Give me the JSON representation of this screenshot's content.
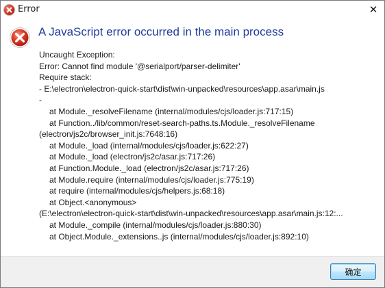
{
  "window": {
    "title": "Error"
  },
  "icons": {
    "title_icon": "error-icon",
    "main_icon": "error-icon",
    "close_icon": "close-icon"
  },
  "dialog": {
    "headline": "A JavaScript error occurred in the main process",
    "message_lines": [
      {
        "text": "Uncaught Exception:",
        "indent": false
      },
      {
        "text": "Error: Cannot find module '@serialport/parser-delimiter'",
        "indent": false
      },
      {
        "text": "Require stack:",
        "indent": false
      },
      {
        "text": "- E:\\electron\\electron-quick-start\\dist\\win-unpacked\\resources\\app.asar\\main.js",
        "indent": false
      },
      {
        "text": "-",
        "indent": false
      },
      {
        "text": "at Module._resolveFilename (internal/modules/cjs/loader.js:717:15)",
        "indent": true
      },
      {
        "text": "at Function../lib/common/reset-search-paths.ts.Module._resolveFilename",
        "indent": true
      },
      {
        "text": "(electron/js2c/browser_init.js:7648:16)",
        "indent": false
      },
      {
        "text": "at Module._load (internal/modules/cjs/loader.js:622:27)",
        "indent": true
      },
      {
        "text": "at Module._load (electron/js2c/asar.js:717:26)",
        "indent": true
      },
      {
        "text": "at Function.Module._load (electron/js2c/asar.js:717:26)",
        "indent": true
      },
      {
        "text": "at Module.require (internal/modules/cjs/loader.js:775:19)",
        "indent": true
      },
      {
        "text": "at require (internal/modules/cjs/helpers.js:68:18)",
        "indent": true
      },
      {
        "text": "at Object.<anonymous>",
        "indent": true
      },
      {
        "text": "(E:\\electron\\electron-quick-start\\dist\\win-unpacked\\resources\\app.asar\\main.js:12:...",
        "indent": false
      },
      {
        "text": "at Module._compile (internal/modules/cjs/loader.js:880:30)",
        "indent": true
      },
      {
        "text": "at Object.Module._extensions..js (internal/modules/cjs/loader.js:892:10)",
        "indent": true
      }
    ]
  },
  "footer": {
    "ok_label": "确定"
  },
  "colors": {
    "headline": "#1e3f9c",
    "error_red": "#d42a1a",
    "footer_bg": "#f0f0f0"
  }
}
